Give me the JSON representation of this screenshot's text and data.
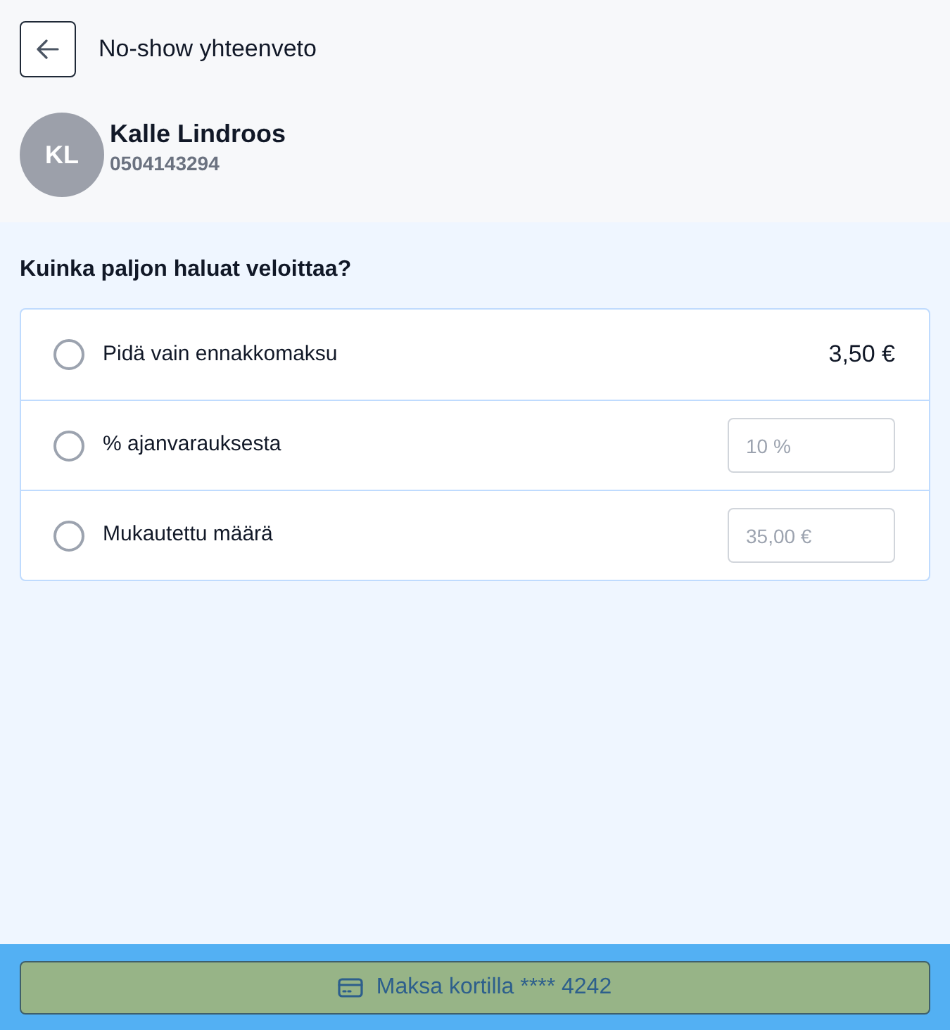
{
  "header": {
    "title": "No-show yhteenveto"
  },
  "customer": {
    "initials": "KL",
    "name": "Kalle Lindroos",
    "phone": "0504143294"
  },
  "question": "Kuinka paljon haluat veloittaa?",
  "options": [
    {
      "kind": "amount",
      "label": "Pidä vain ennakkomaksu",
      "value": "3,50 €",
      "selected": false
    },
    {
      "kind": "input",
      "label": "% ajanvarauksesta",
      "placeholder": "10 %",
      "selected": false
    },
    {
      "kind": "input",
      "label": "Mukautettu määrä",
      "placeholder": "35,00 €",
      "selected": false
    }
  ],
  "pay_button": {
    "label": "Maksa kortilla **** 4242"
  }
}
